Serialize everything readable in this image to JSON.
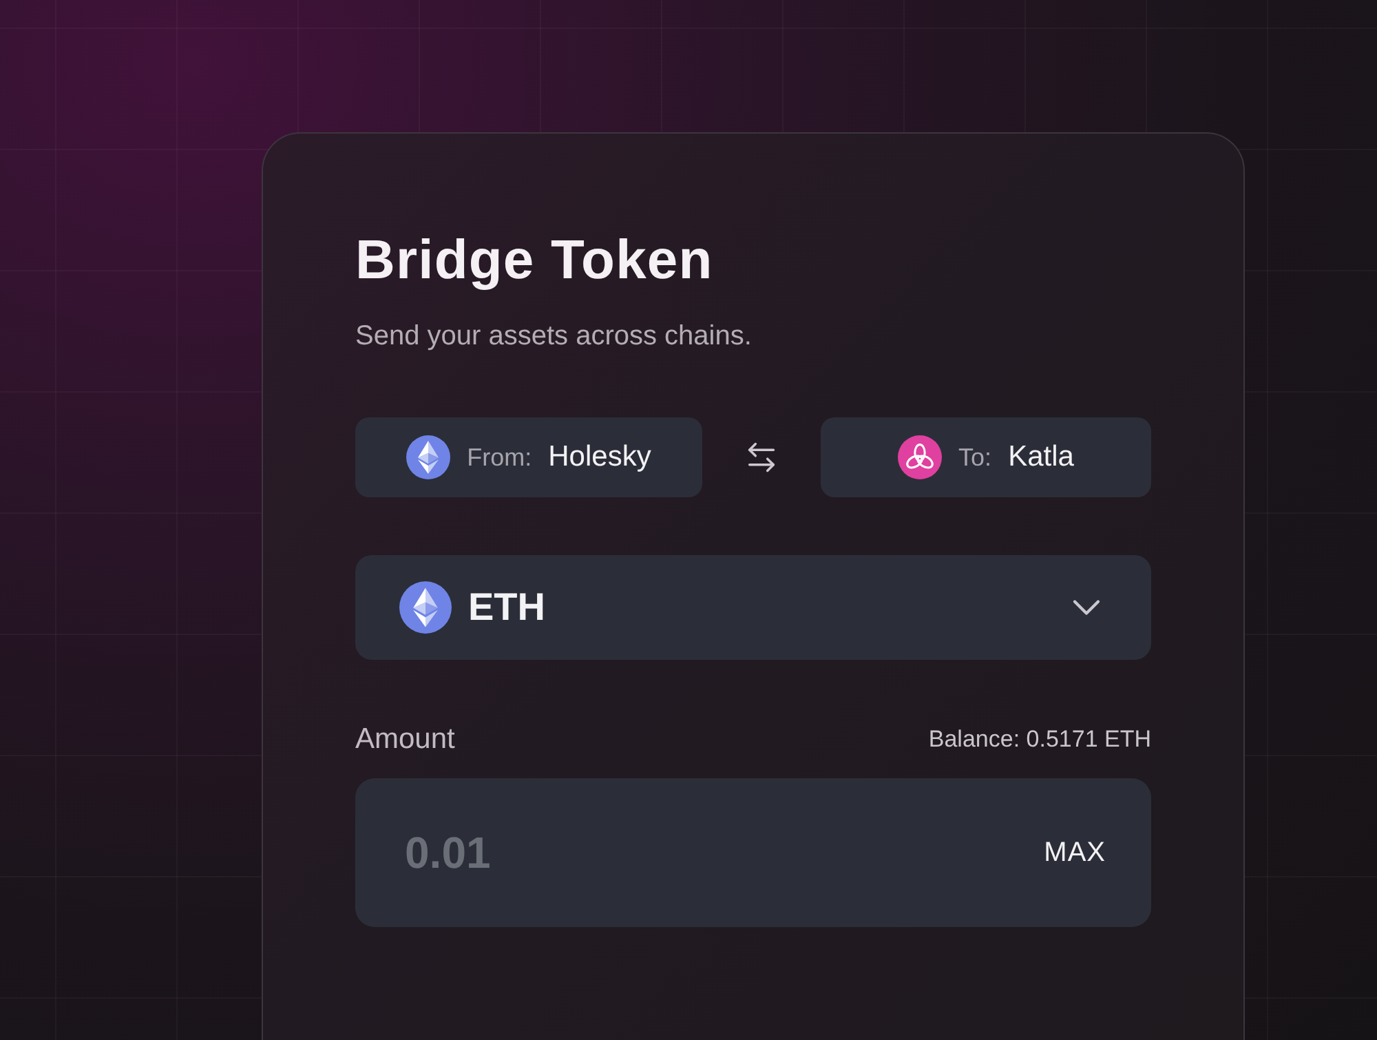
{
  "card": {
    "title": "Bridge Token",
    "subtitle": "Send your assets across chains."
  },
  "chains": {
    "from": {
      "label": "From:",
      "name": "Holesky"
    },
    "to": {
      "label": "To:",
      "name": "Katla"
    }
  },
  "token": {
    "symbol": "ETH"
  },
  "amount": {
    "label": "Amount",
    "balance": "Balance: 0.5171 ETH",
    "placeholder": "0.01",
    "max_button": "MAX"
  }
}
